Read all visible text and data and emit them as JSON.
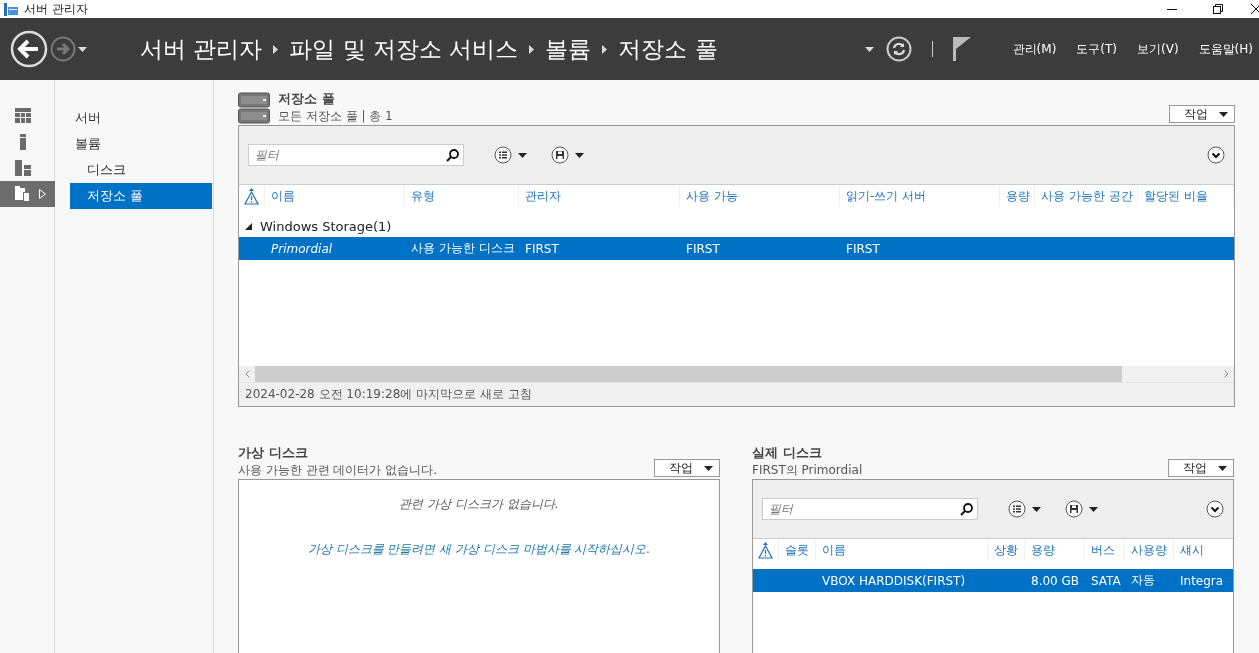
{
  "window": {
    "title": "서버 관리자"
  },
  "header": {
    "breadcrumb": [
      "서버 관리자",
      "파일 및 저장소 서비스",
      "볼륨",
      "저장소 풀"
    ],
    "menus": [
      "관리(M)",
      "도구(T)",
      "보기(V)",
      "도움말(H)"
    ]
  },
  "rail": [
    {
      "kind": "dashboard",
      "selected": false
    },
    {
      "kind": "server",
      "selected": false
    },
    {
      "kind": "servers",
      "selected": false
    },
    {
      "kind": "files",
      "selected": true
    }
  ],
  "nav": [
    {
      "label": "서버",
      "selected": false
    },
    {
      "label": "볼륨",
      "selected": false,
      "children": [
        {
          "label": "디스크",
          "selected": false
        },
        {
          "label": "저장소 풀",
          "selected": true
        }
      ]
    }
  ],
  "storage_pools": {
    "title": "저장소 풀",
    "subtitle": "모든 저장소 풀 | 총 1",
    "task_button": "작업",
    "filter_placeholder": "필터",
    "columns": [
      "이름",
      "유형",
      "관리자",
      "사용 가능",
      "읽기-쓰기 서버",
      "용량",
      "사용 가능한 공간",
      "할당된 비율"
    ],
    "groups": [
      {
        "label": "Windows Storage(1)",
        "expanded": true,
        "rows": [
          {
            "name": "Primordial",
            "type": "사용 가능한 디스크",
            "manager": "FIRST",
            "available": "FIRST",
            "rw_server": "FIRST",
            "selected": true
          }
        ]
      }
    ],
    "status": "2024-02-28 오전 10:19:28에 마지막으로 새로 고침"
  },
  "virtual_disks": {
    "title": "가상 디스크",
    "subtitle": "사용 가능한 관련 데이터가 없습니다.",
    "task_button": "작업",
    "empty_message": "관련 가상 디스크가 없습니다.",
    "hint": "가상 디스크를 만들려면 새 가상 디스크 마법사를 시작하십시오."
  },
  "physical_disks": {
    "title": "실제 디스크",
    "subtitle": "FIRST의 Primordial",
    "task_button": "작업",
    "filter_placeholder": "필터",
    "columns": [
      "슬롯",
      "이름",
      "상황",
      "용량",
      "버스",
      "사용량",
      "섀시"
    ],
    "rows": [
      {
        "name": "VBOX HARDDISK(FIRST)",
        "capacity": "8.00 GB",
        "bus": "SATA",
        "usage": "자동",
        "chassis": "Integra",
        "selected": true
      }
    ]
  }
}
